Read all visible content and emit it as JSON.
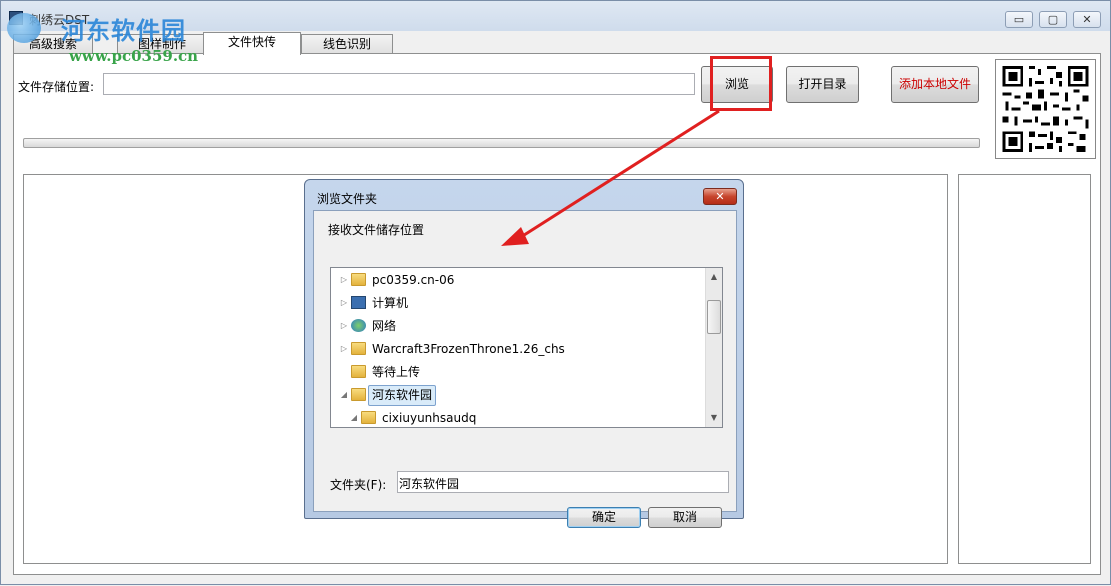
{
  "window": {
    "title": "刺绣云DST"
  },
  "watermark": {
    "site_name": "河东软件园",
    "url": "www.pc0359.cn"
  },
  "titlebar_buttons": {
    "minimize": "▭",
    "restore": "▢",
    "close": "✕"
  },
  "tabs": [
    {
      "label": "高级搜索"
    },
    {
      "label": "图样制作"
    },
    {
      "label": "文件快传"
    },
    {
      "label": "线色识别"
    }
  ],
  "active_tab": "文件快传",
  "form": {
    "save_location_label": "文件存储位置:",
    "save_location_value": ""
  },
  "buttons": {
    "browse": "浏览",
    "open_dir": "打开目录",
    "add_local": "添加本地文件"
  },
  "colors": {
    "add_local_text": "#cc0000",
    "annotation_red": "#e02020"
  },
  "progress": {
    "value": 0
  },
  "dialog": {
    "title": "浏览文件夹",
    "description": "接收文件储存位置",
    "close_glyph": "✕",
    "tree": [
      {
        "label": "pc0359.cn-06",
        "icon": "user-folder-icon",
        "expander": "▷"
      },
      {
        "label": "计算机",
        "icon": "computer-icon",
        "expander": "▷"
      },
      {
        "label": "网络",
        "icon": "network-icon",
        "expander": "▷"
      },
      {
        "label": "Warcraft3FrozenThrone1.26_chs",
        "icon": "folder-icon",
        "expander": "▷"
      },
      {
        "label": "等待上传",
        "icon": "folder-icon",
        "expander": ""
      },
      {
        "label": "河东软件园",
        "icon": "folder-icon",
        "expander": "◢",
        "selected": true
      },
      {
        "label": "cixiuyunhsaudq",
        "icon": "folder-icon",
        "expander": "◢"
      }
    ],
    "scroll_up": "▲",
    "scroll_down": "▼",
    "folder_label": "文件夹(F):",
    "folder_value": "河东软件园",
    "ok": "确定",
    "cancel": "取消"
  }
}
